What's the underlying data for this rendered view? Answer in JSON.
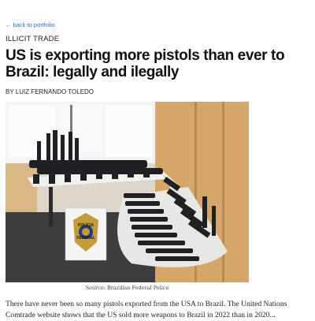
{
  "nav": {
    "back_label": "← back to portfolio"
  },
  "article": {
    "section": "ILLICIT TRADE",
    "title": "US is exporting more pistols than ever to Brazil: legally and ilegally",
    "byline": "BY LUIZ FERNANDO TOLEDO",
    "photo": {
      "caption": "Source: Brazilian Federal Police",
      "badge_top": "POLÍCIA",
      "badge_bottom": "FEDERAL"
    },
    "intro_line1": "There have never been so many pistols exported from the USA to Brazil. The United Nations",
    "intro_line2": "Comtrade website shows that the US sold more weapons to Brazil in 2022 than in 2020..."
  },
  "colors": {
    "link": "#1f74c9",
    "text": "#111111"
  }
}
